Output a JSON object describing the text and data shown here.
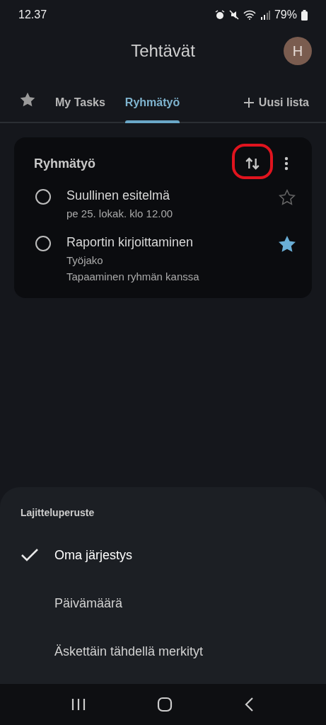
{
  "status_bar": {
    "time": "12.37",
    "battery": "79%"
  },
  "app_bar": {
    "title": "Tehtävät",
    "avatar": "H"
  },
  "tabs": [
    {
      "kind": "starred",
      "selected": false
    },
    {
      "kind": "list",
      "label": "My Tasks",
      "selected": false
    },
    {
      "kind": "list",
      "label": "Ryhmätyö",
      "selected": true
    },
    {
      "kind": "new",
      "label": "Uusi lista",
      "selected": false
    }
  ],
  "list_card": {
    "title": "Ryhmätyö",
    "tasks": [
      {
        "title": "Suullinen esitelmä",
        "details": [
          "pe 25. lokak. klo 12.00"
        ],
        "done": false,
        "starred": false
      },
      {
        "title": "Raportin kirjoittaminen",
        "details": [
          "Työjako",
          "Tapaaminen ryhmän kanssa"
        ],
        "done": false,
        "starred": true
      }
    ]
  },
  "sort_sheet": {
    "title": "Lajitteluperuste",
    "options": [
      {
        "label": "Oma järjestys",
        "selected": true
      },
      {
        "label": "Päivämäärä",
        "selected": false
      },
      {
        "label": "Äskettäin tähdellä merkityt",
        "selected": false
      }
    ]
  }
}
